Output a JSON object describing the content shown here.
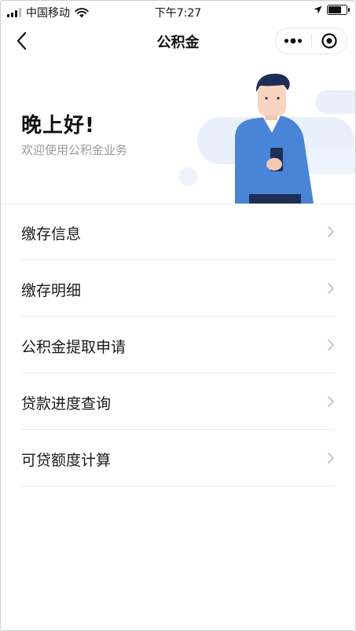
{
  "status_bar": {
    "carrier": "中国移动",
    "time": "下午7:27"
  },
  "nav": {
    "title": "公积金"
  },
  "hero": {
    "greeting": "晚上好!",
    "subtitle": "欢迎使用公积金业务"
  },
  "menu": {
    "items": [
      {
        "label": "缴存信息"
      },
      {
        "label": "缴存明细"
      },
      {
        "label": "公积金提取申请"
      },
      {
        "label": "贷款进度查询"
      },
      {
        "label": "可贷额度计算"
      }
    ]
  },
  "colors": {
    "accent_blue": "#4a84d6",
    "navy": "#1d2f56",
    "bg_shape": "#e9f0fb"
  }
}
